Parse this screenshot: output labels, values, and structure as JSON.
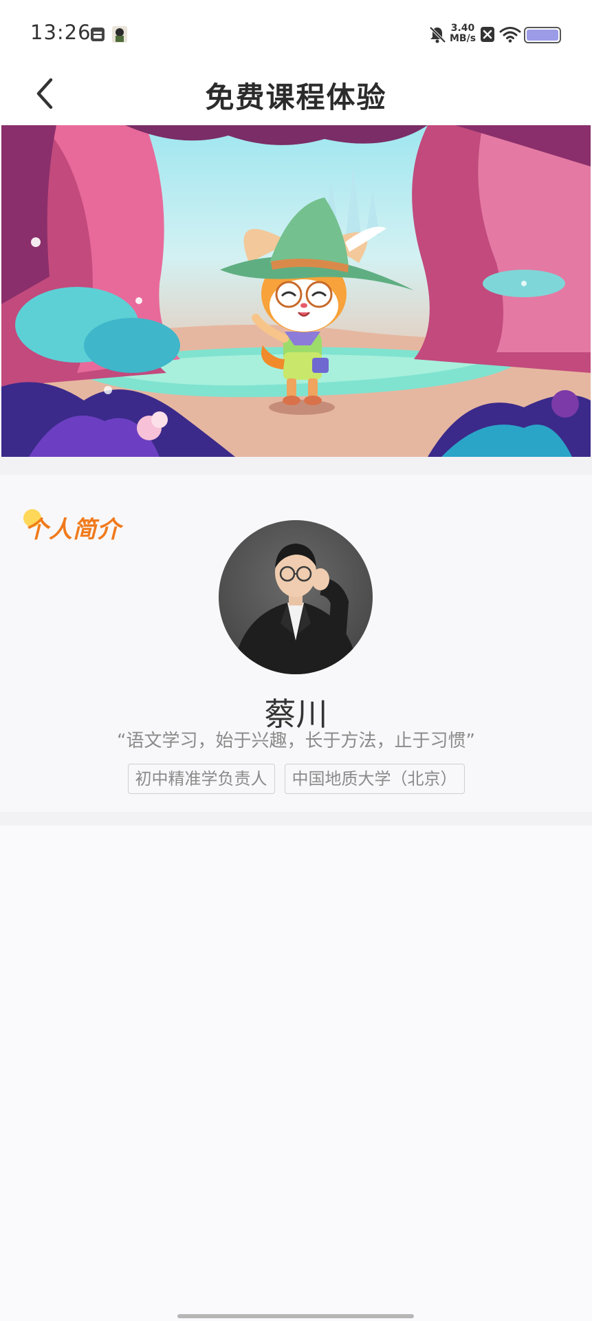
{
  "status_bar": {
    "time": "13:26",
    "speed_value": "3.40",
    "speed_unit": "MB/s",
    "icons": [
      "notification-box-icon",
      "app-thumbnail-icon",
      "bell-muted-icon",
      "close-box-icon",
      "wifi-icon",
      "battery-icon"
    ]
  },
  "header": {
    "title": "免费课程体验",
    "back_icon": "chevron-left-icon"
  },
  "profile": {
    "section_title": "个人简介",
    "name": "蔡川",
    "motto": "“语文学习，始于兴趣，长于方法，止于习惯”",
    "tags": [
      "初中精准学负责人",
      "中国地质大学（北京）"
    ]
  },
  "colors": {
    "accent_orange": "#f07a1c",
    "page_background": "#fafafc"
  }
}
